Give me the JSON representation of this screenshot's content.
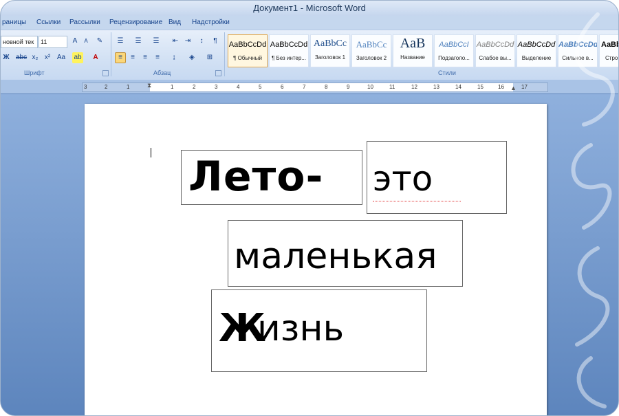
{
  "window": {
    "title": "Документ1 - Microsoft Word"
  },
  "ribbon_tabs": [
    "раницы",
    "Ссылки",
    "Рассылки",
    "Рецензирование",
    "Вид",
    "Надстройки"
  ],
  "font": {
    "name": "новной тек",
    "size": "11"
  },
  "groups": {
    "font": "Шрифт",
    "paragraph": "Абзац",
    "styles": "Стили"
  },
  "styles": [
    {
      "sample": "AaBbCcDd",
      "name": "¶ Обычный"
    },
    {
      "sample": "AaBbCcDd",
      "name": "¶ Без интер..."
    },
    {
      "sample": "AaBbCc",
      "name": "Заголовок 1"
    },
    {
      "sample": "AaBbCc",
      "name": "Заголовок 2"
    },
    {
      "sample": "AaB",
      "name": "Название"
    },
    {
      "sample": "AaBbCcI",
      "name": "Подзаголо..."
    },
    {
      "sample": "AaBbCcDd",
      "name": "Слабое вы..."
    },
    {
      "sample": "AaBbCcDd",
      "name": "Выделение"
    },
    {
      "sample": "AaBbCcDd",
      "name": "Сильное в..."
    },
    {
      "sample": "AaBbC",
      "name": "Стро"
    }
  ],
  "ruler_numbers": [
    "3",
    "2",
    "1",
    "1",
    "2",
    "3",
    "4",
    "5",
    "6",
    "7",
    "8",
    "9",
    "10",
    "11",
    "12",
    "13",
    "14",
    "15",
    "16",
    "17"
  ],
  "document": {
    "box1": "Лето-",
    "box2": "это",
    "box3": "маленькая",
    "box4_first": "Ж",
    "box4_rest": "изнь"
  },
  "colors": {
    "selected_style": "#fff7e0",
    "ribbon": "#d2e1f4",
    "doc_background": "#7297cd"
  }
}
